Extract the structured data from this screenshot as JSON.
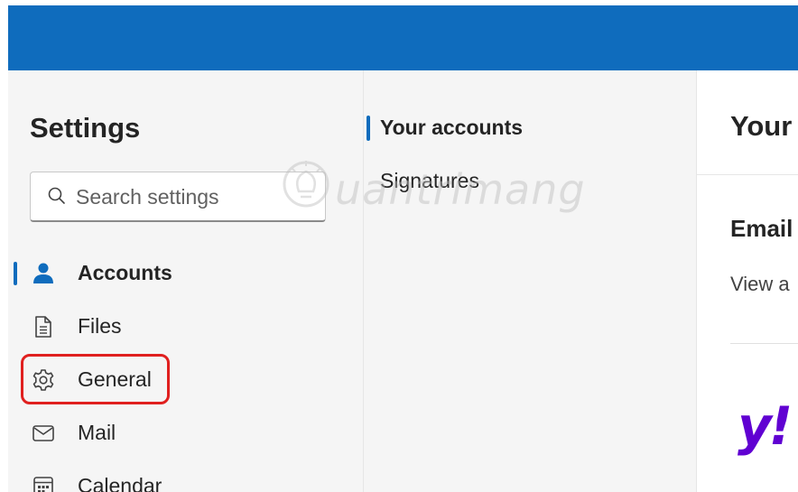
{
  "settings": {
    "title": "Settings",
    "search": {
      "placeholder": "Search settings",
      "value": ""
    }
  },
  "nav": {
    "items": [
      {
        "label": "Accounts",
        "icon": "person-icon",
        "selected": true
      },
      {
        "label": "Files",
        "icon": "file-icon"
      },
      {
        "label": "General",
        "icon": "gear-icon",
        "highlighted": true
      },
      {
        "label": "Mail",
        "icon": "mail-icon"
      },
      {
        "label": "Calendar",
        "icon": "calendar-icon"
      }
    ]
  },
  "subnav": {
    "items": [
      {
        "label": "Your accounts",
        "selected": true
      },
      {
        "label": "Signatures"
      }
    ]
  },
  "content": {
    "title": "Your",
    "email_heading": "Email",
    "description": "View a",
    "provider_logo": "y!"
  },
  "watermark": {
    "text": "uantrimang"
  },
  "colors": {
    "header": "#0f6cbd",
    "accent": "#0f6cbd",
    "highlight": "#e0201f",
    "yahoo": "#6001d2"
  }
}
